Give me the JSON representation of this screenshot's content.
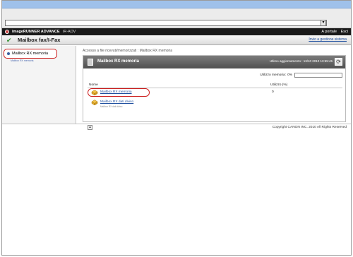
{
  "browser": {
    "dropdown_symbol": "▾"
  },
  "brand": {
    "name": "imageRUNNER ADVANCE",
    "model": "iR-ADV",
    "links": [
      "A portale",
      "Esci"
    ]
  },
  "header": {
    "title": "Mailbox fax/I-Fax",
    "back_link": "Invio a gestione sistema"
  },
  "sidebar": {
    "item_label": "Mailbox RX memoria",
    "sub_text": "Mailbox RX memoria"
  },
  "main": {
    "breadcrumb": "Accesso a file ricevuti/memorizzati : Mailbox RX memoria",
    "panel": {
      "title": "Mailbox RX memoria",
      "last_update": "Ultimo aggiornamento : 13/10 2010 13:55:45",
      "refresh_icon": "refresh-icon",
      "usage_label": "Utilizzo memoria:",
      "usage_value": "0%",
      "usage_fraction": 0,
      "columns": [
        "Nome",
        "Utilizzo (%)"
      ],
      "rows": [
        {
          "name": "Mailbox RX memoria",
          "usage": "0",
          "sub": ""
        },
        {
          "name": "Mailbox RX dati diviso",
          "usage": "",
          "sub": "Mailbox RX dati diviso"
        }
      ]
    }
  },
  "footer": {
    "copyright": "Copyright CANON INC. 2010 All Rights Reserved"
  },
  "colors": {
    "highlight_oval": "#cc1d1d",
    "panel_header": "#4f4f4f",
    "link": "#1f4f9f"
  }
}
